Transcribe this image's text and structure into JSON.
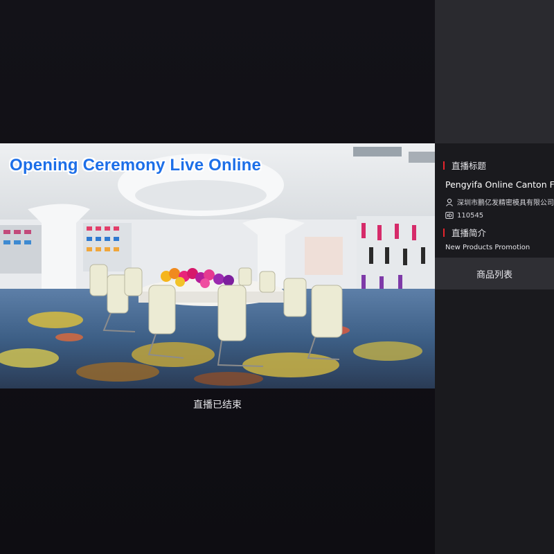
{
  "video": {
    "overlay_title": "Opening Ceremony Live Online",
    "status_text": "直播已结束"
  },
  "sidebar": {
    "title_section_label": "直播标题",
    "stream_title": "Pengyifa Online Canton Fair",
    "company_name": "深圳市鹏亿发精密模具有限公司",
    "room_id": "110545",
    "intro_section_label": "直播简介",
    "intro_text": "New Products Promotion",
    "product_tab_label": "商品列表"
  },
  "colors": {
    "accent_red": "#e8242c",
    "overlay_blue": "#1d6fe8",
    "page_bg": "#111015",
    "sidebar_bg": "#1a1a1e"
  }
}
